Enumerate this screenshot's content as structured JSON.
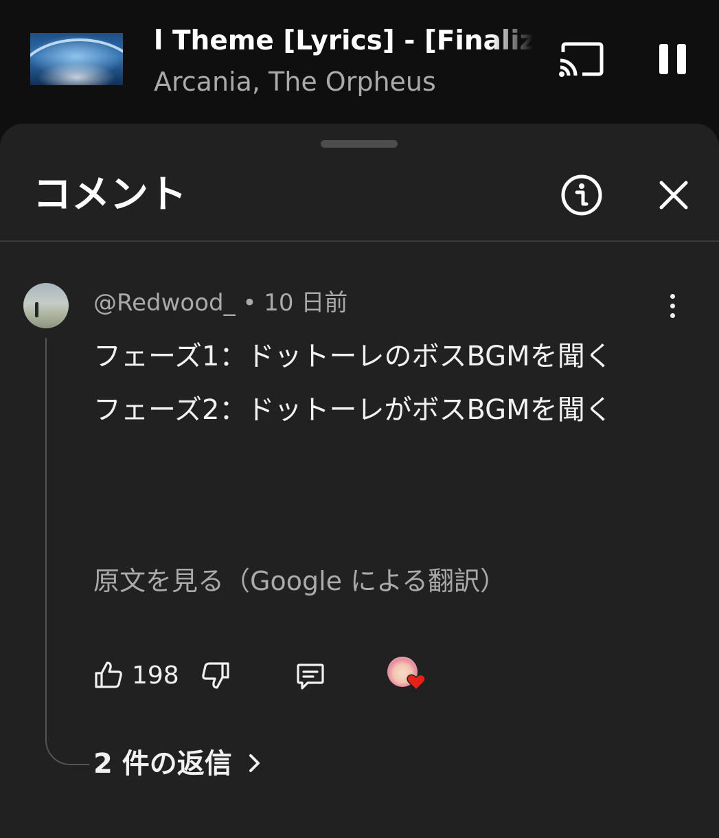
{
  "player": {
    "title": "l Theme [Lyrics] - [Finalized",
    "artist": "Arcania, The Orpheus",
    "icons": {
      "cast": "cast-icon",
      "pause": "pause-icon"
    }
  },
  "sheet": {
    "title": "コメント",
    "icons": {
      "info": "info-icon",
      "close": "close-icon"
    }
  },
  "comment": {
    "author": "@Redwood_",
    "separator": " • ",
    "time": "10 日前",
    "lines": [
      "フェーズ1：ドットーレのボスBGMを聞く",
      "フェーズ2：ドットーレがボスBGMを聞く"
    ],
    "see_original": "原文を見る（Google による翻訳）",
    "like_count": "198",
    "replies_label": "2 件の返信",
    "icons": {
      "more": "more-vert-icon",
      "like": "thumb-up-icon",
      "dislike": "thumb-down-icon",
      "reply": "reply-icon",
      "creator_heart": "creator-heart-icon",
      "chevron": "chevron-right-icon"
    },
    "colors": {
      "heart": "#e62117"
    }
  }
}
